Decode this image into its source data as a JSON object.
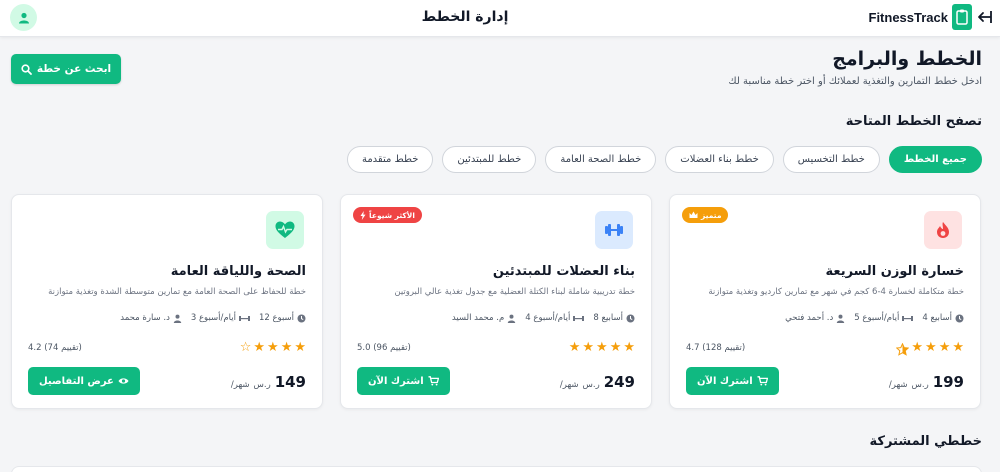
{
  "header": {
    "title": "إدارة الخطط",
    "brand_name": "FitnessTrack",
    "avatar_icon": "user-icon",
    "exit_icon": "logout-icon"
  },
  "actions": {
    "search_label": "ابحث عن خطة"
  },
  "page": {
    "title": "الخطط والبرامج",
    "subtitle": "ادخل خطط التمارين والتغذية لعملائك أو اختر خطة مناسبة لك"
  },
  "browse": {
    "title": "تصفح الخطط المتاحة",
    "tabs": [
      {
        "label": "جميع الخطط",
        "active": true
      },
      {
        "label": "خطط التخسيس",
        "active": false
      },
      {
        "label": "خطط بناء العضلات",
        "active": false
      },
      {
        "label": "خطط الصحة العامة",
        "active": false
      },
      {
        "label": "خطط للمبتدئين",
        "active": false
      },
      {
        "label": "خطط متقدمة",
        "active": false
      }
    ]
  },
  "plans": [
    {
      "title": "خسارة الوزن السريعة",
      "description": "خطة متكاملة لخسارة 4-6 كجم في شهر مع تمارين كارديو وتغذية متوازنة",
      "icon": "fire-icon",
      "icon_bg": "#fee2e2",
      "icon_color": "#ef4444",
      "badge": "متميز",
      "badge_icon": "crown-icon",
      "badge_color": "#f59e0b",
      "duration": "4 أسابيع",
      "frequency": "5 أيام/أسبوع",
      "trainer": "د. أحمد فتحي",
      "stars": 4.5,
      "rating_text": "4.7 (128 تقييم)",
      "price": "199",
      "currency": "ر.س",
      "period": "/شهر",
      "button": "اشترك الآن",
      "button_icon": "cart-icon"
    },
    {
      "title": "بناء العضلات للمبتدئين",
      "description": "خطة تدريبية شاملة لبناء الكتلة العضلية مع جدول تغذية عالي البروتين",
      "icon": "dumbbell-icon",
      "icon_bg": "#dbeafe",
      "icon_color": "#3b82f6",
      "badge": "الأكثر شيوعاً",
      "badge_icon": "bolt-icon",
      "badge_color": "#ef4444",
      "duration": "8 أسابيع",
      "frequency": "4 أيام/أسبوع",
      "trainer": "م. محمد السيد",
      "stars": 5,
      "rating_text": "5.0 (96 تقييم)",
      "price": "249",
      "currency": "ر.س",
      "period": "/شهر",
      "button": "اشترك الآن",
      "button_icon": "cart-icon"
    },
    {
      "title": "الصحة واللياقة العامة",
      "description": "خطة للحفاظ على الصحة العامة مع تمارين متوسطة الشدة وتغذية متوازنة",
      "icon": "heartbeat-icon",
      "icon_bg": "#d1fae5",
      "icon_color": "#10b981",
      "badge": "",
      "badge_icon": "",
      "badge_color": "",
      "duration": "12 أسبوع",
      "frequency": "3 أيام/أسبوع",
      "trainer": "د. سارة محمد",
      "stars": 4,
      "rating_text": "4.2 (74 تقييم)",
      "price": "149",
      "currency": "ر.س",
      "period": "/شهر",
      "button": "عرض التفاصيل",
      "button_icon": "eye-icon"
    }
  ],
  "shared": {
    "title": "خططي المشتركة"
  },
  "colors": {
    "accent": "#10b981",
    "star": "#f59e0b",
    "badge_red": "#ef4444",
    "badge_gold": "#f59e0b"
  }
}
